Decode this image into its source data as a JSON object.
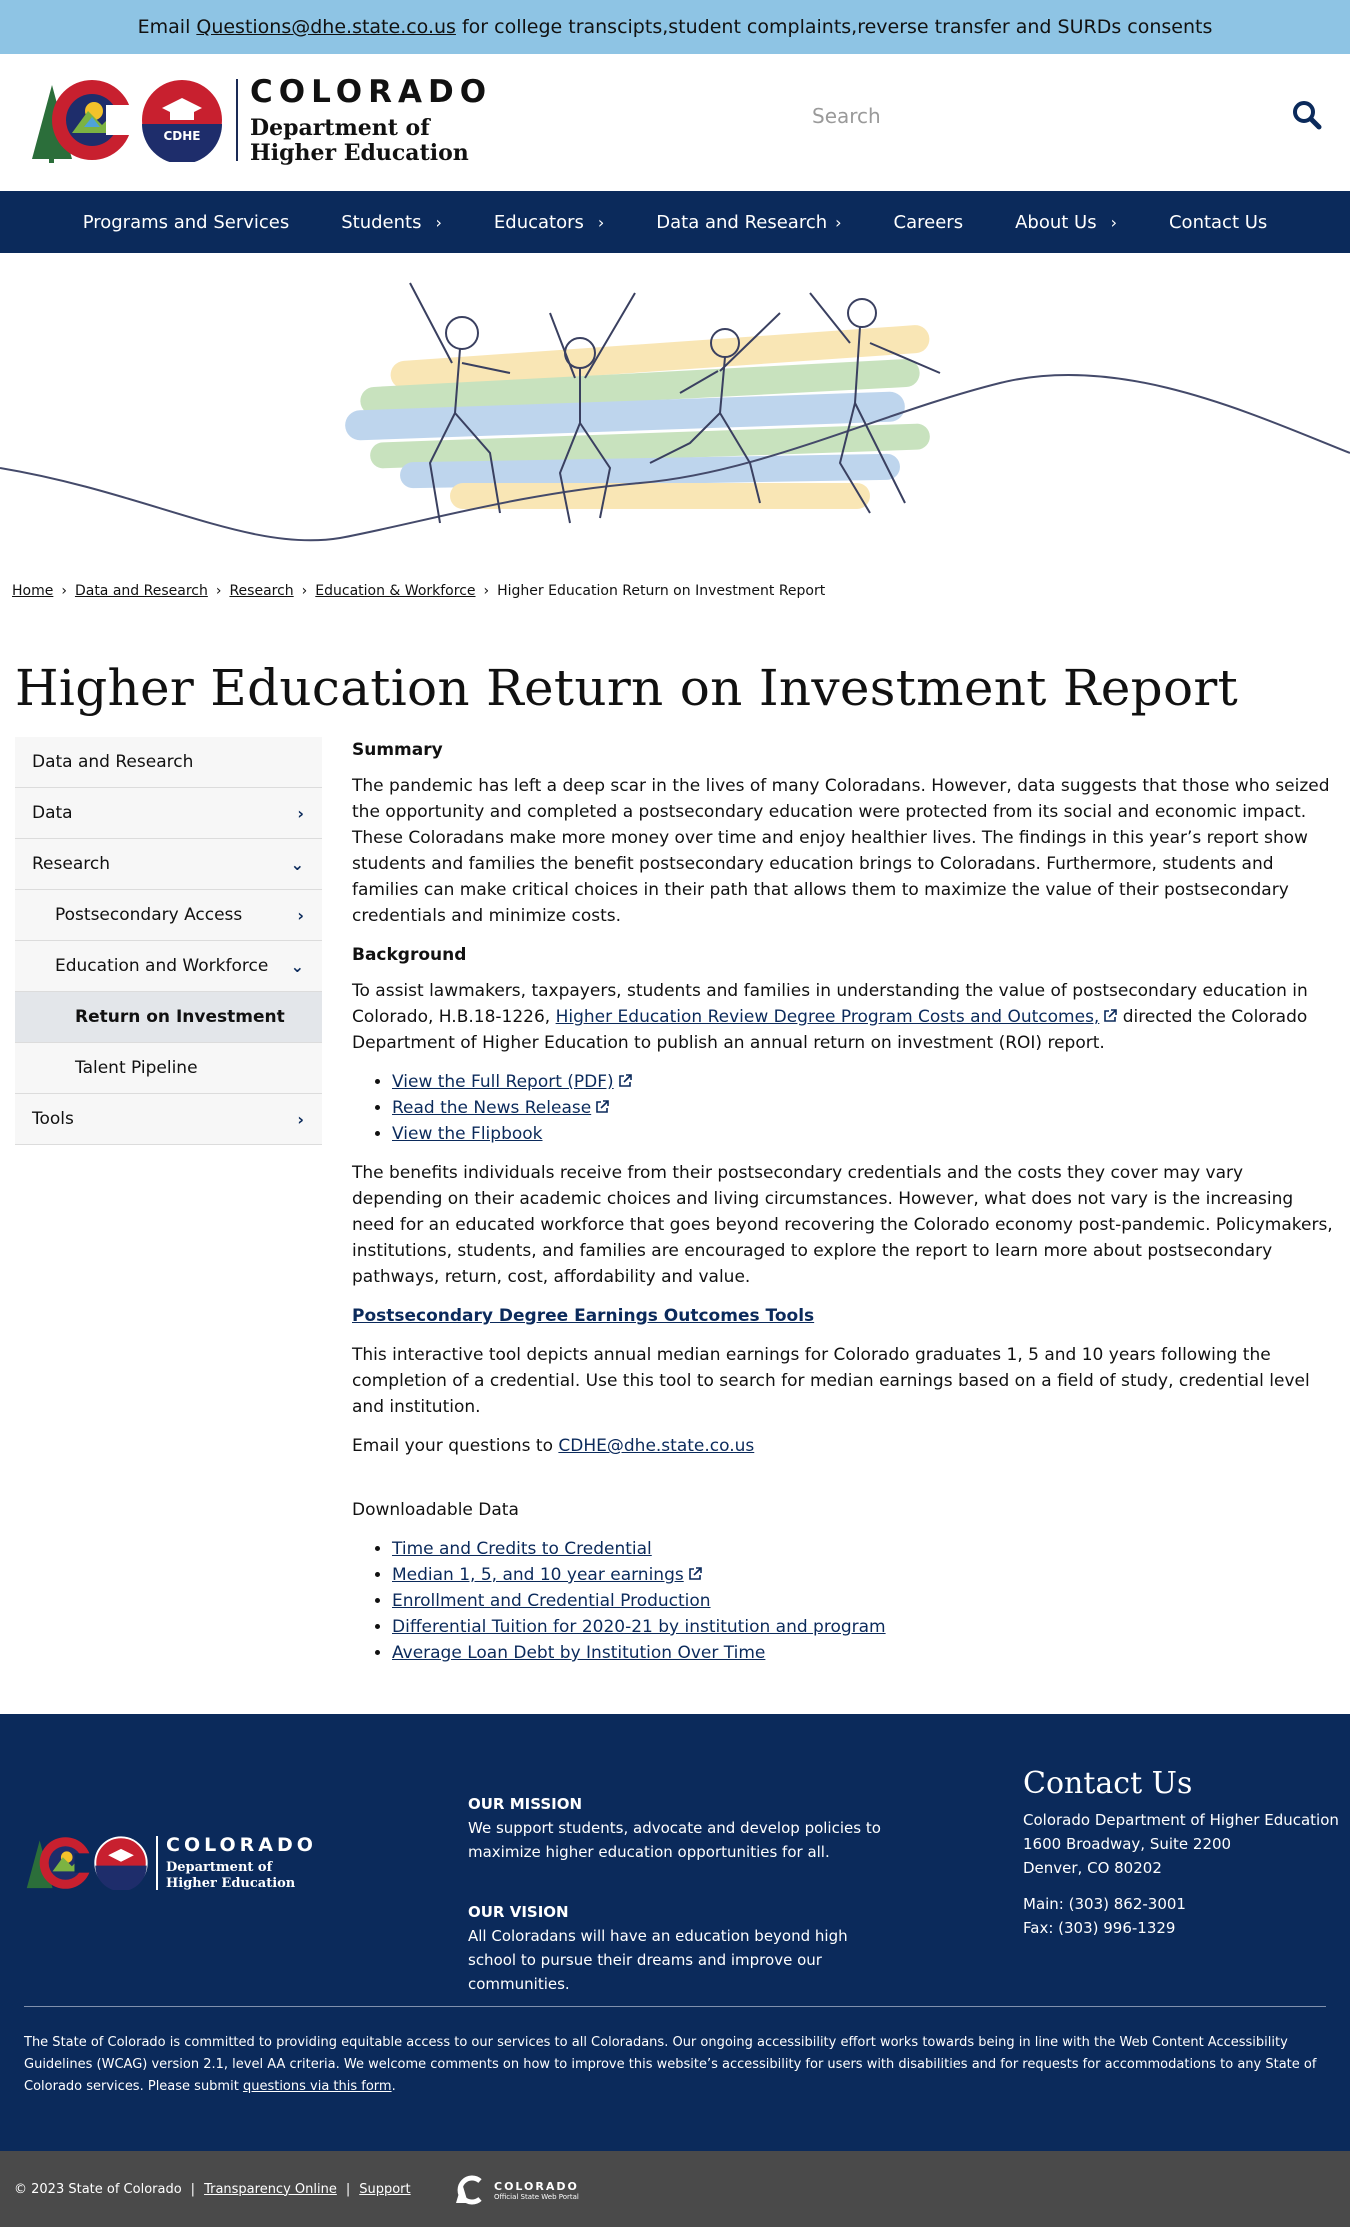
{
  "banner": {
    "prefix": "Email",
    "email": "Questions@dhe.state.co.us",
    "suffix": "for college transcipts,student complaints,reverse transfer and SURDs consents"
  },
  "header": {
    "logo_state": "COLORADO",
    "logo_dept_line1": "Department of",
    "logo_dept_line2": "Higher Education",
    "seal_text": "CDHE",
    "search_placeholder": "Search",
    "search_icon": "search-icon"
  },
  "nav": {
    "items": [
      {
        "label": "Programs and Services",
        "has_submenu": false
      },
      {
        "label": "Students",
        "has_submenu": true
      },
      {
        "label": "Educators",
        "has_submenu": true
      },
      {
        "label": "Data and Research",
        "has_submenu": true
      },
      {
        "label": "Careers",
        "has_submenu": false
      },
      {
        "label": "About Us",
        "has_submenu": true
      },
      {
        "label": "Contact Us",
        "has_submenu": false
      }
    ]
  },
  "breadcrumb": {
    "items": [
      "Home",
      "Data and Research",
      "Research",
      "Education & Workforce"
    ],
    "current": "Higher Education Return on Investment Report"
  },
  "page_title": "Higher Education Return on Investment Report",
  "sidebar": {
    "items": [
      {
        "label": "Data and Research",
        "chevron": ""
      },
      {
        "label": "Data",
        "chevron": "right"
      },
      {
        "label": "Research",
        "chevron": "down"
      },
      {
        "label": "Postsecondary Access",
        "chevron": "right"
      },
      {
        "label": "Education and Workforce",
        "chevron": "down"
      },
      {
        "label": "Return on Investment",
        "chevron": "",
        "active": true
      },
      {
        "label": "Talent Pipeline",
        "chevron": ""
      },
      {
        "label": "Tools",
        "chevron": "right"
      }
    ]
  },
  "main": {
    "summary_heading": "Summary",
    "summary_text": "The pandemic has left a deep scar in the lives of many Coloradans. However, data suggests that those who seized the opportunity and completed a postsecondary education were protected from its social and economic impact. These Coloradans make more money over time and enjoy healthier lives. The findings in this year’s report show students and families the benefit postsecondary education brings to Coloradans. Furthermore, students and families can make critical choices in their path that allows them to maximize the value of their postsecondary credentials and minimize costs.",
    "background_heading": "Background",
    "background_prefix": "To assist lawmakers, taxpayers, students and families in understanding the value of postsecondary education in Colorado, H.B.18-1226,",
    "background_link": "Higher Education Review Degree Program Costs and Outcomes,",
    "background_suffix": "directed the Colorado Department of Higher Education to publish an annual return on investment (ROI) report.",
    "report_links": [
      {
        "label": "View the Full Report (PDF)",
        "external": true
      },
      {
        "label": "Read the News Release",
        "external": true
      },
      {
        "label": "View the Flipbook",
        "external": false
      }
    ],
    "benefits_text": "The benefits individuals receive from their postsecondary credentials and the costs they cover may vary depending on their academic choices and living circumstances. However, what does not vary is the increasing need for an educated workforce that goes beyond recovering the Colorado economy post-pandemic. Policymakers, institutions, students, and families are encouraged to explore the report to learn more about postsecondary pathways, return, cost, affordability and value.",
    "tools_link": "Postsecondary Degree Earnings Outcomes Tools",
    "tools_text": "This interactive tool depicts annual median earnings for Colorado graduates 1, 5 and 10 years following the completion of a credential. Use this tool to search for median earnings based on a field of study, credential level and institution.",
    "email_prefix": "Email your questions to",
    "email_link": "CDHE@dhe.state.co.us",
    "downloadable_heading": "Downloadable Data",
    "downloads": [
      {
        "label": "Time and Credits to Credential",
        "external": false
      },
      {
        "label": "Median 1, 5, and 10 year earnings",
        "external": true
      },
      {
        "label": "Enrollment and Credential Production",
        "external": false
      },
      {
        "label": "Differential Tuition for 2020-21 by institution and program",
        "external": false
      },
      {
        "label": "Average Loan Debt by Institution Over Time",
        "external": false
      }
    ]
  },
  "footer": {
    "mission_heading": "OUR MISSION",
    "mission_text": "We support students, advocate and develop policies to maximize higher education opportunities for all.",
    "vision_heading": "OUR VISION",
    "vision_text": "All Coloradans will have an education beyond high school to pursue their dreams and improve our communities.",
    "contact_heading": "Contact Us",
    "address_line1": "Colorado Department of Higher Education",
    "address_line2": "1600 Broadway, Suite 2200",
    "address_line3": "Denver, CO 80202",
    "phone": "Main: (303) 862-3001",
    "fax": "Fax: (303) 996-1329",
    "accessibility_text": "The State of Colorado is committed to providing equitable access to our services to all Coloradans. Our ongoing accessibility effort works towards being in line with the Web Content Accessibility Guidelines (WCAG) version 2.1, level AA criteria. We welcome comments on how to improve this website’s accessibility for users with disabilities and for requests for accommodations to any State of Colorado services. Please submit",
    "accessibility_link": "questions via this form",
    "accessibility_end": "."
  },
  "bottom_bar": {
    "copyright": "© 2023 State of Colorado",
    "transparency": "Transparency Online",
    "support": "Support",
    "portal_name": "COLORADO",
    "portal_sub": "Official State Web Portal"
  },
  "colors": {
    "navy": "#0b2a5b",
    "banner_blue": "#8ec4e4",
    "bottom_gray": "#4a4a4a"
  }
}
